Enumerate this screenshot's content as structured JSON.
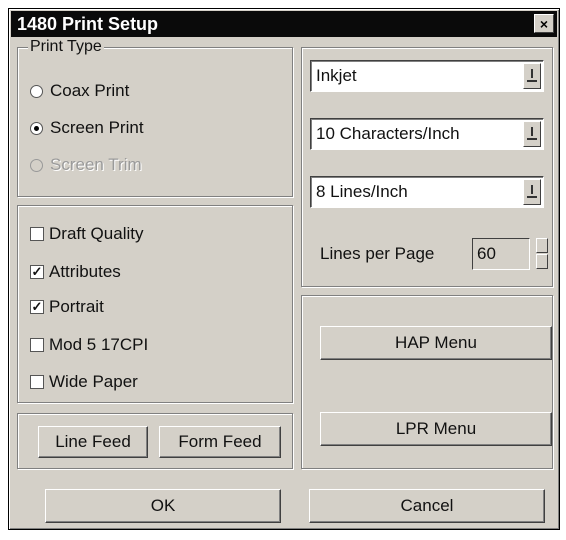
{
  "window": {
    "title": "1480 Print Setup",
    "close_glyph": "×"
  },
  "print_type": {
    "legend": "Print Type",
    "options": [
      {
        "label": "Coax Print",
        "selected": false,
        "enabled": true
      },
      {
        "label": "Screen Print",
        "selected": true,
        "enabled": true
      },
      {
        "label": "Screen Trim",
        "selected": false,
        "enabled": false
      }
    ]
  },
  "options": {
    "checkboxes": [
      {
        "label": "Draft Quality",
        "checked": false
      },
      {
        "label": "Attributes",
        "checked": true
      },
      {
        "label": "Portrait",
        "checked": true
      },
      {
        "label": "Mod 5 17CPI",
        "checked": false
      },
      {
        "label": "Wide Paper",
        "checked": false
      }
    ]
  },
  "feed_buttons": {
    "line_feed": "Line Feed",
    "form_feed": "Form Feed"
  },
  "settings": {
    "printer": "Inkjet",
    "cpi": "10 Characters/Inch",
    "lpi": "8 Lines/Inch",
    "lines_per_page_label": "Lines per Page",
    "lines_per_page": "60"
  },
  "menus": {
    "hap": "HAP Menu",
    "lpr": "LPR Menu"
  },
  "footer": {
    "ok": "OK",
    "cancel": "Cancel"
  },
  "check_glyph": "✓"
}
